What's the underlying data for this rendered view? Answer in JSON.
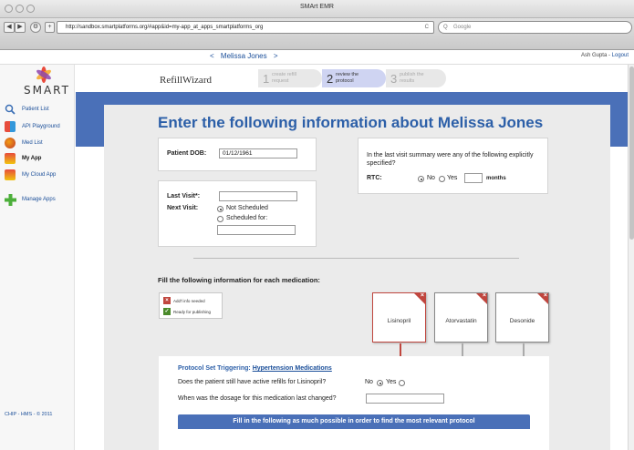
{
  "window": {
    "title": "SMArt EMR"
  },
  "browser": {
    "url": "http://sandbox.smartplatforms.org/#app&id=my-app_at_apps_smartplatforms_org",
    "search_placeholder": "Google",
    "reload_label": "C",
    "back_label": "◀",
    "forward_label": "▶",
    "add_label": "+"
  },
  "header": {
    "prev": "<",
    "patient_name": "Melissa Jones",
    "next": ">",
    "user": "Ash Gupta",
    "separator": " - ",
    "logout": "Logout"
  },
  "sidebar": {
    "logo": "SMART",
    "items": [
      {
        "label": "Patient List",
        "icon": "magnifier-icon"
      },
      {
        "label": "API Playground",
        "icon": "blocks-icon"
      },
      {
        "label": "Med List",
        "icon": "pill-icon"
      },
      {
        "label": "My App",
        "icon": "app-icon"
      },
      {
        "label": "My Cloud App",
        "icon": "cloud-app-icon"
      },
      {
        "label": "Manage Apps",
        "icon": "plus-icon"
      }
    ],
    "footer": "CHIP - HMS - © 2011"
  },
  "wizard": {
    "app_name": "RefillWizard",
    "steps": [
      {
        "num": "1",
        "line1": "create refill",
        "line2": "request"
      },
      {
        "num": "2",
        "line1": "review the",
        "line2": "protocol"
      },
      {
        "num": "3",
        "line1": "publish the",
        "line2": "results"
      }
    ]
  },
  "form": {
    "title": "Enter the following information about Melissa Jones",
    "dob_label": "Patient DOB:",
    "dob_value": "01/12/1961",
    "summary_q": "In the last visit summary were any of the following explicitly specified?",
    "rtc_label": "RTC:",
    "no_label": "No",
    "yes_label": "Yes",
    "months_label": "months",
    "last_visit_label": "Last Visit*:",
    "next_visit_label": "Next Visit:",
    "not_scheduled": "Not Scheduled",
    "scheduled_for": "Scheduled for:",
    "med_heading": "Fill the following information for each medication:",
    "legend_needed": "Add'l info needed",
    "legend_ready": "Ready for publishing",
    "meds": [
      "Lisinopril",
      "Atorvastatin",
      "Desonide"
    ],
    "protocol_prefix": "Protocol Set Triggering:",
    "protocol_link": "Hypertension Medications",
    "q1": "Does the patient still have active refills for Lisinopril?",
    "q1_no": "No",
    "q1_yes": "Yes",
    "q2": "When was the dosage for this medication last changed?",
    "button_text": "Fill in the following as much possible in order to find the most relevant protocol"
  },
  "colors": {
    "accent": "#4a70b8",
    "title": "#2c5fa8",
    "flag": "#c0463e",
    "ready": "#4a8a2a"
  }
}
